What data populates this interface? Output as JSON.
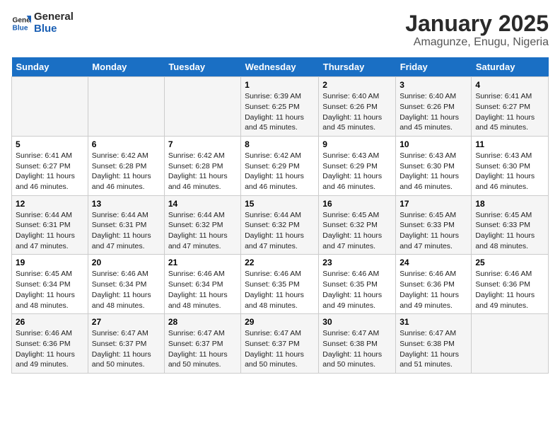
{
  "logo": {
    "line1": "General",
    "line2": "Blue"
  },
  "title": "January 2025",
  "subtitle": "Amagunze, Enugu, Nigeria",
  "days_of_week": [
    "Sunday",
    "Monday",
    "Tuesday",
    "Wednesday",
    "Thursday",
    "Friday",
    "Saturday"
  ],
  "weeks": [
    [
      {
        "num": "",
        "info": ""
      },
      {
        "num": "",
        "info": ""
      },
      {
        "num": "",
        "info": ""
      },
      {
        "num": "1",
        "info": "Sunrise: 6:39 AM\nSunset: 6:25 PM\nDaylight: 11 hours and 45 minutes."
      },
      {
        "num": "2",
        "info": "Sunrise: 6:40 AM\nSunset: 6:26 PM\nDaylight: 11 hours and 45 minutes."
      },
      {
        "num": "3",
        "info": "Sunrise: 6:40 AM\nSunset: 6:26 PM\nDaylight: 11 hours and 45 minutes."
      },
      {
        "num": "4",
        "info": "Sunrise: 6:41 AM\nSunset: 6:27 PM\nDaylight: 11 hours and 45 minutes."
      }
    ],
    [
      {
        "num": "5",
        "info": "Sunrise: 6:41 AM\nSunset: 6:27 PM\nDaylight: 11 hours and 46 minutes."
      },
      {
        "num": "6",
        "info": "Sunrise: 6:42 AM\nSunset: 6:28 PM\nDaylight: 11 hours and 46 minutes."
      },
      {
        "num": "7",
        "info": "Sunrise: 6:42 AM\nSunset: 6:28 PM\nDaylight: 11 hours and 46 minutes."
      },
      {
        "num": "8",
        "info": "Sunrise: 6:42 AM\nSunset: 6:29 PM\nDaylight: 11 hours and 46 minutes."
      },
      {
        "num": "9",
        "info": "Sunrise: 6:43 AM\nSunset: 6:29 PM\nDaylight: 11 hours and 46 minutes."
      },
      {
        "num": "10",
        "info": "Sunrise: 6:43 AM\nSunset: 6:30 PM\nDaylight: 11 hours and 46 minutes."
      },
      {
        "num": "11",
        "info": "Sunrise: 6:43 AM\nSunset: 6:30 PM\nDaylight: 11 hours and 46 minutes."
      }
    ],
    [
      {
        "num": "12",
        "info": "Sunrise: 6:44 AM\nSunset: 6:31 PM\nDaylight: 11 hours and 47 minutes."
      },
      {
        "num": "13",
        "info": "Sunrise: 6:44 AM\nSunset: 6:31 PM\nDaylight: 11 hours and 47 minutes."
      },
      {
        "num": "14",
        "info": "Sunrise: 6:44 AM\nSunset: 6:32 PM\nDaylight: 11 hours and 47 minutes."
      },
      {
        "num": "15",
        "info": "Sunrise: 6:44 AM\nSunset: 6:32 PM\nDaylight: 11 hours and 47 minutes."
      },
      {
        "num": "16",
        "info": "Sunrise: 6:45 AM\nSunset: 6:32 PM\nDaylight: 11 hours and 47 minutes."
      },
      {
        "num": "17",
        "info": "Sunrise: 6:45 AM\nSunset: 6:33 PM\nDaylight: 11 hours and 47 minutes."
      },
      {
        "num": "18",
        "info": "Sunrise: 6:45 AM\nSunset: 6:33 PM\nDaylight: 11 hours and 48 minutes."
      }
    ],
    [
      {
        "num": "19",
        "info": "Sunrise: 6:45 AM\nSunset: 6:34 PM\nDaylight: 11 hours and 48 minutes."
      },
      {
        "num": "20",
        "info": "Sunrise: 6:46 AM\nSunset: 6:34 PM\nDaylight: 11 hours and 48 minutes."
      },
      {
        "num": "21",
        "info": "Sunrise: 6:46 AM\nSunset: 6:34 PM\nDaylight: 11 hours and 48 minutes."
      },
      {
        "num": "22",
        "info": "Sunrise: 6:46 AM\nSunset: 6:35 PM\nDaylight: 11 hours and 48 minutes."
      },
      {
        "num": "23",
        "info": "Sunrise: 6:46 AM\nSunset: 6:35 PM\nDaylight: 11 hours and 49 minutes."
      },
      {
        "num": "24",
        "info": "Sunrise: 6:46 AM\nSunset: 6:36 PM\nDaylight: 11 hours and 49 minutes."
      },
      {
        "num": "25",
        "info": "Sunrise: 6:46 AM\nSunset: 6:36 PM\nDaylight: 11 hours and 49 minutes."
      }
    ],
    [
      {
        "num": "26",
        "info": "Sunrise: 6:46 AM\nSunset: 6:36 PM\nDaylight: 11 hours and 49 minutes."
      },
      {
        "num": "27",
        "info": "Sunrise: 6:47 AM\nSunset: 6:37 PM\nDaylight: 11 hours and 50 minutes."
      },
      {
        "num": "28",
        "info": "Sunrise: 6:47 AM\nSunset: 6:37 PM\nDaylight: 11 hours and 50 minutes."
      },
      {
        "num": "29",
        "info": "Sunrise: 6:47 AM\nSunset: 6:37 PM\nDaylight: 11 hours and 50 minutes."
      },
      {
        "num": "30",
        "info": "Sunrise: 6:47 AM\nSunset: 6:38 PM\nDaylight: 11 hours and 50 minutes."
      },
      {
        "num": "31",
        "info": "Sunrise: 6:47 AM\nSunset: 6:38 PM\nDaylight: 11 hours and 51 minutes."
      },
      {
        "num": "",
        "info": ""
      }
    ]
  ]
}
